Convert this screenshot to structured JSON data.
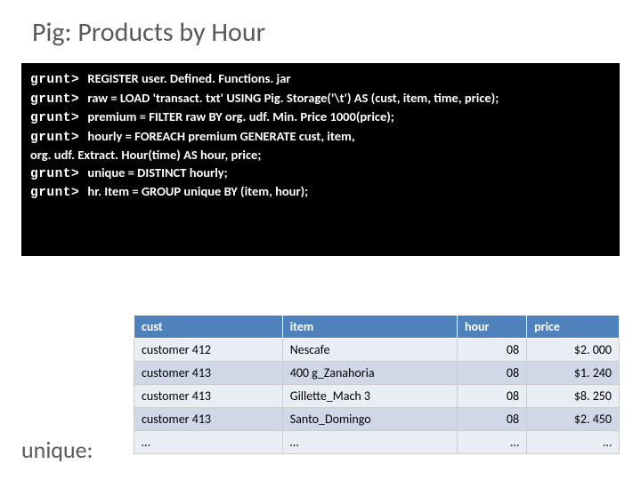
{
  "title": "Pig: Products by Hour",
  "terminal": {
    "prompt": "grunt>",
    "lines": [
      {
        "withPrompt": true,
        "text": "REGISTER user. Defined. Functions. jar"
      },
      {
        "withPrompt": true,
        "text": "raw = LOAD 'transact. txt' USING Pig. Storage('\\t') AS (cust, item, time, price);"
      },
      {
        "withPrompt": true,
        "text": "premium = FILTER raw BY org. udf. Min. Price 1000(price);"
      },
      {
        "withPrompt": true,
        "text": "hourly = FOREACH premium GENERATE cust, item,"
      },
      {
        "withPrompt": false,
        "text": "org. udf. Extract. Hour(time) AS hour, price;"
      },
      {
        "withPrompt": true,
        "text": "unique = DISTINCT hourly;"
      },
      {
        "withPrompt": true,
        "text": "hr. Item = GROUP unique BY (item, hour);"
      }
    ]
  },
  "table": {
    "headers": [
      "cust",
      "item",
      "hour",
      "price"
    ],
    "rows": [
      {
        "cust": "customer 412",
        "item": "Nescafe",
        "hour": "08",
        "price": "$2. 000"
      },
      {
        "cust": "customer 413",
        "item": "400 g_Zanahoria",
        "hour": "08",
        "price": "$1. 240"
      },
      {
        "cust": "customer 413",
        "item": "Gillette_Mach 3",
        "hour": "08",
        "price": "$8. 250"
      },
      {
        "cust": "customer 413",
        "item": "Santo_Domingo",
        "hour": "08",
        "price": "$2. 450"
      },
      {
        "cust": "…",
        "item": "…",
        "hour": "…",
        "price": "…"
      }
    ]
  },
  "uniqueLabel": "unique:"
}
